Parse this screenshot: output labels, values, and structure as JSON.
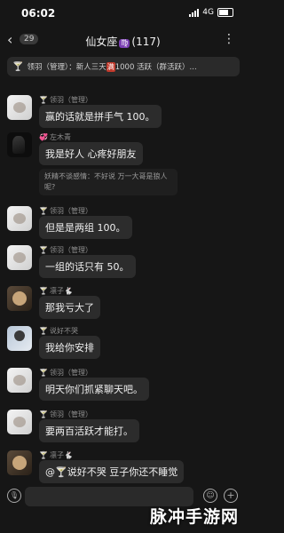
{
  "status_bar": {
    "time": "06:02",
    "network": "4G"
  },
  "nav": {
    "back_glyph": "‹",
    "unread_count": "29",
    "title": "仙女座",
    "zodiac": "♍",
    "member_count": "(117)",
    "menu_glyph": "⋮"
  },
  "notice": {
    "text_a": "领羽（管理）：新人三天",
    "hot": "满",
    "text_b": "1000 活跃（群活跃）..."
  },
  "messages": [
    {
      "avatar": "avatar-white",
      "prefix": "管理",
      "name": "领羽（管理）",
      "text": "赢的话就是拼手气 100。"
    },
    {
      "avatar": "avatar-dark",
      "prefix": "",
      "name": "左木青",
      "text": "我是好人 心疼好朋友",
      "reply": "妖精不谈感情：不好说 万一大哥是狼人呢?"
    },
    {
      "avatar": "avatar-white",
      "prefix": "管理",
      "name": "领羽（管理）",
      "text": "但是是两组 100。"
    },
    {
      "avatar": "avatar-white",
      "prefix": "管理",
      "name": "领羽（管理）",
      "text": "一组的话只有 50。"
    },
    {
      "avatar": "avatar-dog",
      "prefix": "",
      "name": "凛子🐇",
      "text": "那我亏大了"
    },
    {
      "avatar": "avatar-person",
      "prefix": "",
      "name": "说好不哭",
      "text": "我给你安排"
    },
    {
      "avatar": "avatar-white",
      "prefix": "管理",
      "name": "领羽（管理）",
      "text": "明天你们抓紧聊天吧。"
    },
    {
      "avatar": "avatar-white",
      "prefix": "管理",
      "name": "领羽（管理）",
      "text": "要两百活跃才能打。"
    },
    {
      "avatar": "avatar-dog",
      "prefix": "",
      "name": "凛子🐇",
      "text": "@🍸说好不哭 豆子你还不睡觉"
    }
  ],
  "input": {
    "placeholder": "",
    "voice_glyph": "🎙",
    "emoji_glyph": "☺",
    "plus_glyph": "+"
  },
  "watermark": "脉冲手游网"
}
